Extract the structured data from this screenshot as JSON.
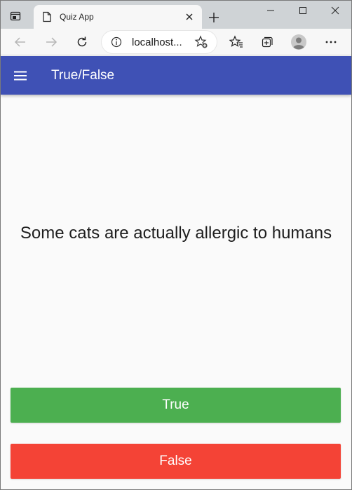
{
  "browser": {
    "tab_title": "Quiz App",
    "address": "localhost..."
  },
  "app": {
    "title": "True/False",
    "primary_color": "#3f51b5"
  },
  "quiz": {
    "question": "Some cats are actually allergic to humans",
    "answers": [
      {
        "label": "True",
        "color": "#4caf50"
      },
      {
        "label": "False",
        "color": "#f44336"
      }
    ]
  },
  "icons": {
    "tab_actions": "tab-actions-icon",
    "page": "page-icon",
    "close": "close-icon",
    "new_tab": "plus-icon",
    "minimize": "minimize-icon",
    "maximize": "maximize-icon",
    "window_close": "window-close-icon",
    "back": "back-arrow-icon",
    "forward": "forward-arrow-icon",
    "refresh": "refresh-icon",
    "info": "info-icon",
    "add_favorite": "add-favorite-icon",
    "favorites": "favorites-icon",
    "collections": "collections-icon",
    "profile": "profile-avatar-icon",
    "more": "more-icon",
    "menu": "hamburger-menu-icon"
  }
}
